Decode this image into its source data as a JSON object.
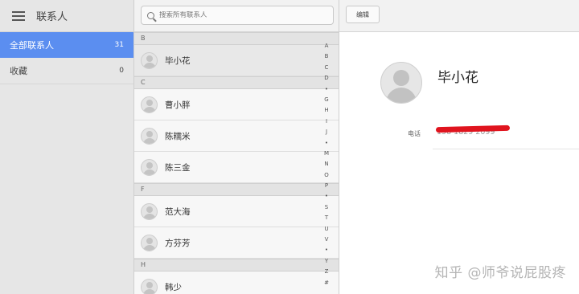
{
  "sidebar": {
    "title": "联系人",
    "items": [
      {
        "label": "全部联系人",
        "count": "31"
      },
      {
        "label": "收藏",
        "count": "0"
      }
    ]
  },
  "search": {
    "placeholder": "搜索所有联系人"
  },
  "contact_list": {
    "groups": [
      {
        "letter": "B",
        "contacts": [
          "毕小花"
        ]
      },
      {
        "letter": "C",
        "contacts": [
          "曹小胖",
          "陈糯米",
          "陈三金"
        ]
      },
      {
        "letter": "F",
        "contacts": [
          "范大海",
          "方芬芳"
        ]
      },
      {
        "letter": "H",
        "contacts": [
          "韩少"
        ]
      }
    ],
    "selected": "毕小花"
  },
  "alpha_index": [
    "A",
    "B",
    "C",
    "D",
    "•",
    "G",
    "H",
    "I",
    "J",
    "•",
    "M",
    "N",
    "O",
    "P",
    "•",
    "S",
    "T",
    "U",
    "V",
    "•",
    "Y",
    "Z",
    "#"
  ],
  "detail": {
    "edit_label": "编辑",
    "name": "毕小花",
    "phone_label": "电话",
    "phone_value": "158 1829 2099"
  },
  "watermark": "知乎 @师爷说屁股疼",
  "colors": {
    "accent": "#5b8ef0",
    "redact": "#e0141e"
  },
  "icons": {
    "menu": "hamburger-menu-icon",
    "search": "magnifier-icon",
    "avatar": "default-person-avatar-icon"
  }
}
